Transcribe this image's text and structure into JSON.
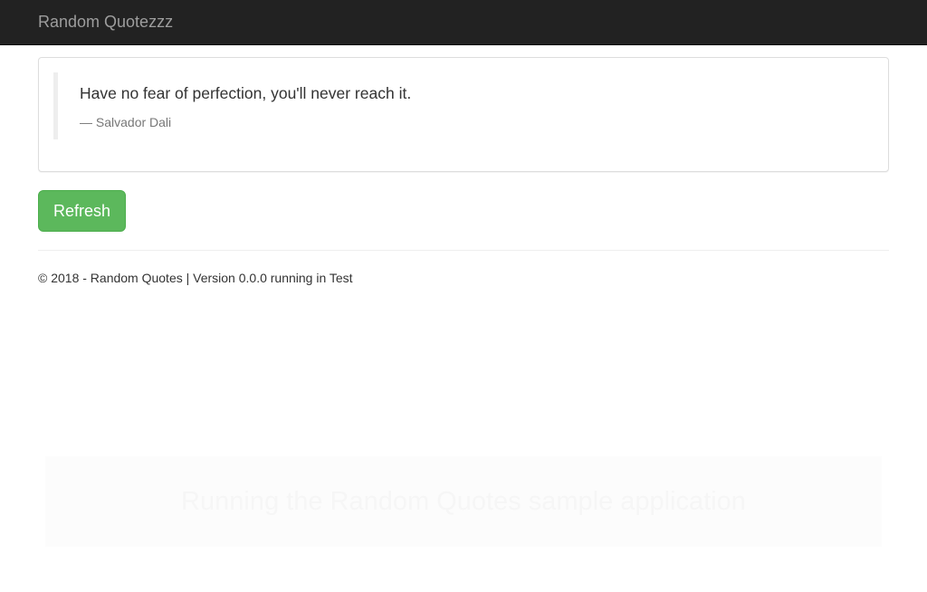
{
  "navbar": {
    "brand": "Random Quotezzz",
    "background": "#222222"
  },
  "quote": {
    "text": "Have no fear of perfection, you'll never reach it.",
    "author": "— Salvador Dali"
  },
  "actions": {
    "refresh_label": "Refresh",
    "refresh_color": "#5cb85c"
  },
  "footer": {
    "text": "© 2018 - Random Quotes | Version 0.0.0 running in Test"
  },
  "banner": {
    "text": "Running the Random Quotes sample application"
  }
}
